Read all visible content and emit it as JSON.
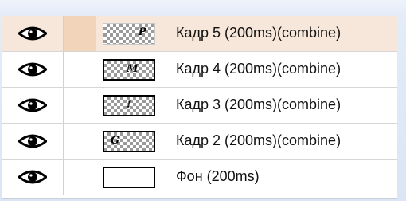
{
  "layers": [
    {
      "label": "Кадр 5 (200ms)(combine)",
      "thumb_glyph": "P",
      "selected": true,
      "visible_icon": "eye-icon"
    },
    {
      "label": "Кадр 4 (200ms)(combine)",
      "thumb_glyph": "M",
      "selected": false,
      "visible_icon": "eye-icon"
    },
    {
      "label": "Кадр 3 (200ms)(combine)",
      "thumb_glyph": "!",
      "selected": false,
      "visible_icon": "eye-icon"
    },
    {
      "label": "Кадр 2 (200ms)(combine)",
      "thumb_glyph": "G",
      "selected": false,
      "visible_icon": "eye-icon"
    },
    {
      "label": "Фон (200ms)",
      "thumb_glyph": "",
      "selected": false,
      "visible_icon": "eye-icon"
    }
  ],
  "colors": {
    "selected_row": "#f6e7da",
    "selected_sep": "#f2d4bb",
    "checker": "#9a9a9a"
  }
}
